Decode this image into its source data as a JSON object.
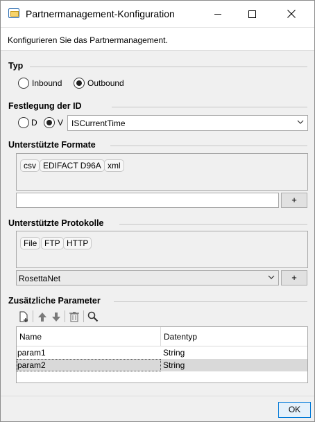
{
  "window": {
    "title": "Partnermanagement-Konfiguration",
    "subtitle": "Konfigurieren Sie das Partnermanagement."
  },
  "typ": {
    "title": "Typ",
    "options": [
      {
        "label": "Inbound",
        "checked": false
      },
      {
        "label": "Outbound",
        "checked": true
      }
    ]
  },
  "id_section": {
    "title": "Festlegung der ID",
    "options": [
      {
        "label": "D",
        "checked": false
      },
      {
        "label": "V",
        "checked": true
      }
    ],
    "value": "ISCurrentTime"
  },
  "formats": {
    "title": "Unterstützte Formate",
    "items": [
      "csv",
      "EDIFACT D96A",
      "xml"
    ],
    "input_value": "",
    "add_label": "+"
  },
  "protocols": {
    "title": "Unterstützte Protokolle",
    "items": [
      "File",
      "FTP",
      "HTTP"
    ],
    "selected": "RosettaNet",
    "add_label": "+"
  },
  "params": {
    "title": "Zusätzliche Parameter",
    "toolbar": [
      "add-icon",
      "move-up-icon",
      "move-down-icon",
      "delete-icon",
      "search-icon"
    ],
    "columns": [
      "Name",
      "Datentyp"
    ],
    "rows": [
      {
        "name": "param1",
        "type": "String"
      },
      {
        "name": "param2",
        "type": "String"
      }
    ]
  },
  "footer": {
    "ok_label": "OK"
  }
}
